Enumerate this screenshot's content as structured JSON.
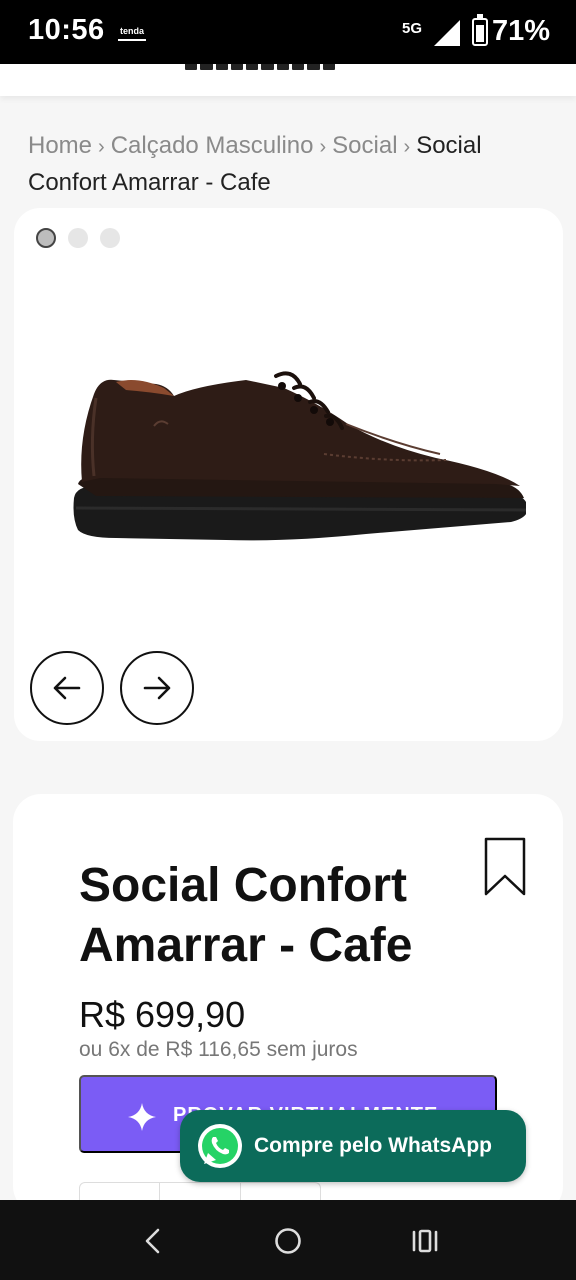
{
  "status_bar": {
    "time": "10:56",
    "app_indicator": "tenda",
    "network": "5G",
    "battery_percent": "71%",
    "battery_level": 0.71
  },
  "breadcrumb": {
    "home": "Home",
    "category": "Calçado Masculino",
    "subcategory": "Social",
    "current": "Social Confort Amarrar - Cafe"
  },
  "gallery": {
    "image_count": 3,
    "active_index": 0,
    "prev_icon": "arrow-left-icon",
    "next_icon": "arrow-right-icon"
  },
  "product": {
    "title": "Social Confort Amarrar - Cafe",
    "price": "R$ 699,90",
    "installments": "ou 6x de R$ 116,65 sem juros",
    "try_on_label": "PROVAR VIRTUALMENTE",
    "bookmark_icon": "bookmark-icon"
  },
  "whatsapp": {
    "label": "Compre pelo WhatsApp"
  },
  "colors": {
    "accent": "#7b5cf5",
    "whatsapp": "#0c6b5a",
    "shoe": "#2e1c16"
  }
}
